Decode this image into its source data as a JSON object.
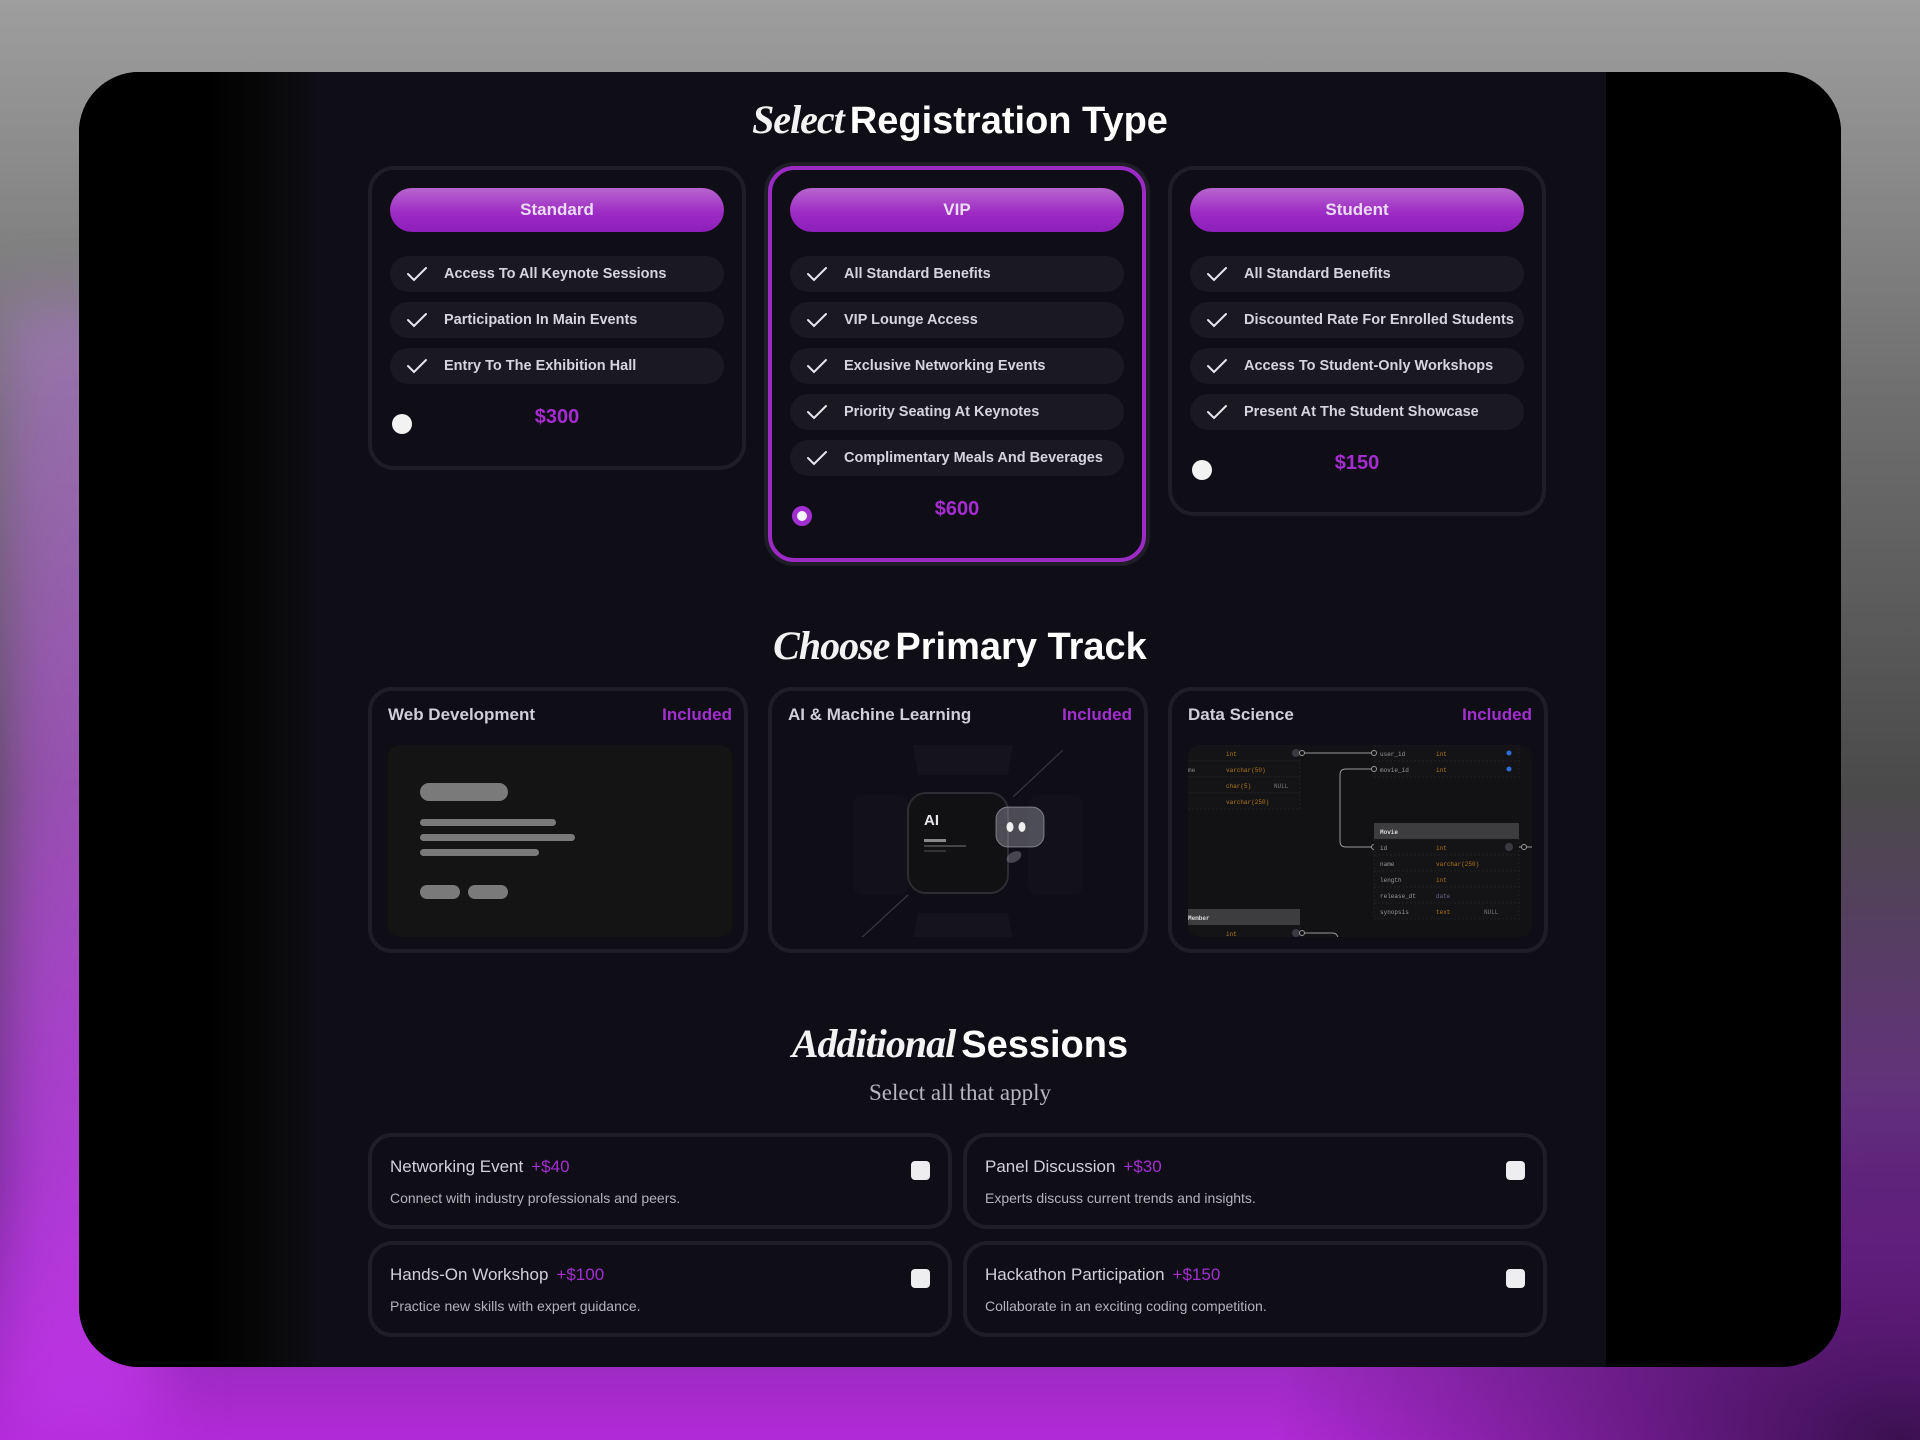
{
  "registration": {
    "title_emphasis": "Select",
    "title_rest": "Registration Type",
    "plans": [
      {
        "name": "Standard",
        "features": [
          "Access To All Keynote Sessions",
          "Participation In Main Events",
          "Entry To The Exhibition Hall"
        ],
        "price": "$300",
        "selected": false
      },
      {
        "name": "VIP",
        "features": [
          "All Standard Benefits",
          "VIP Lounge Access",
          "Exclusive Networking Events",
          "Priority Seating At Keynotes",
          "Complimentary Meals And Beverages"
        ],
        "price": "$600",
        "selected": true
      },
      {
        "name": "Student",
        "features": [
          "All Standard Benefits",
          "Discounted Rate For Enrolled Students",
          "Access To Student-Only Workshops",
          "Present At The Student Showcase"
        ],
        "price": "$150",
        "selected": false
      }
    ]
  },
  "tracks": {
    "title_emphasis": "Choose",
    "title_rest": "Primary Track",
    "items": [
      {
        "name": "Web Development",
        "badge": "Included",
        "illustration": "webpage-skeleton"
      },
      {
        "name": "AI & Machine Learning",
        "badge": "Included",
        "illustration": "ai-robot",
        "chip_label": "AI"
      },
      {
        "name": "Data Science",
        "badge": "Included",
        "illustration": "database-schema",
        "schema": {
          "table_a_rows": [
            [
              "",
              "int",
              "PK",
              ""
            ],
            [
              "me",
              "varchar(50)",
              "",
              ""
            ],
            [
              "",
              "char(5)",
              "NULL",
              ""
            ],
            [
              "",
              "varchar(250)",
              "",
              ""
            ]
          ],
          "table_b_rows": [
            [
              "user_id",
              "int",
              ""
            ],
            [
              "movie_id",
              "int",
              ""
            ]
          ],
          "movie_title": "Movie",
          "movie_rows": [
            [
              "id",
              "int",
              "PK"
            ],
            [
              "name",
              "varchar(250)",
              ""
            ],
            [
              "length",
              "int",
              ""
            ],
            [
              "release_dt",
              "date",
              ""
            ],
            [
              "synopsis",
              "text",
              "NULL"
            ]
          ],
          "member_title": "Member",
          "member_rows": [
            [
              "",
              "int",
              "PK"
            ]
          ]
        }
      }
    ]
  },
  "sessions": {
    "title_emphasis": "Additional",
    "title_rest": "Sessions",
    "subtitle": "Select all that apply",
    "items": [
      {
        "name": "Networking Event",
        "price": "+$40",
        "description": "Connect with industry professionals and peers.",
        "checked": false
      },
      {
        "name": "Panel Discussion",
        "price": "+$30",
        "description": "Experts discuss current trends and insights.",
        "checked": false
      },
      {
        "name": "Hands-On Workshop",
        "price": "+$100",
        "description": "Practice new skills with expert guidance.",
        "checked": false
      },
      {
        "name": "Hackathon Participation",
        "price": "+$150",
        "description": "Collaborate in an exciting coding competition.",
        "checked": false
      }
    ]
  },
  "colors": {
    "accent": "#a32fd0",
    "pill_top": "#b865cf",
    "pill_bottom": "#8e1fba",
    "panel_bg": "#0f0d16",
    "chip_bg": "#1a1922"
  }
}
